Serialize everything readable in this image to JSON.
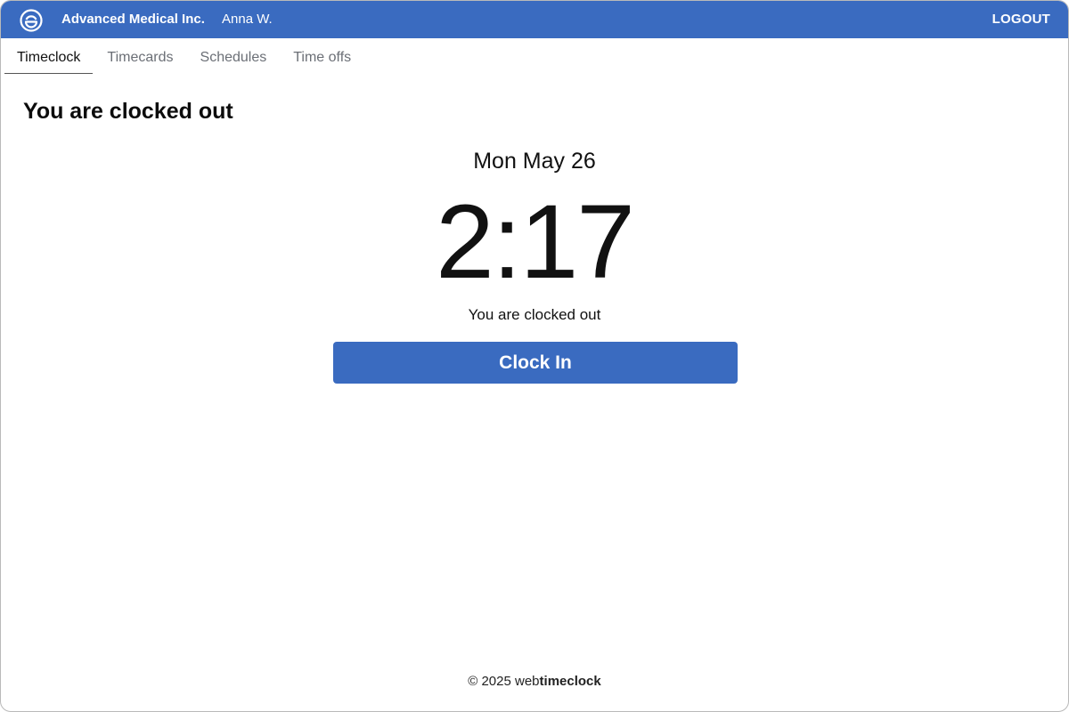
{
  "header": {
    "logo_icon": "webtimeclock-logo-icon",
    "company": "Advanced Medical Inc.",
    "user": "Anna W.",
    "logout_label": "LOGOUT",
    "bar_color": "#3a6bc0"
  },
  "tabs": [
    {
      "label": "Timeclock",
      "active": true
    },
    {
      "label": "Timecards",
      "active": false
    },
    {
      "label": "Schedules",
      "active": false
    },
    {
      "label": "Time offs",
      "active": false
    }
  ],
  "main": {
    "heading": "You are clocked out",
    "date": "Mon May 26",
    "time": "2:17",
    "status": "You are clocked out",
    "clock_in_label": "Clock In",
    "button_color": "#3a6bc0"
  },
  "footer": {
    "copyright": "© 2025 web",
    "brand_bold": "timeclock"
  }
}
